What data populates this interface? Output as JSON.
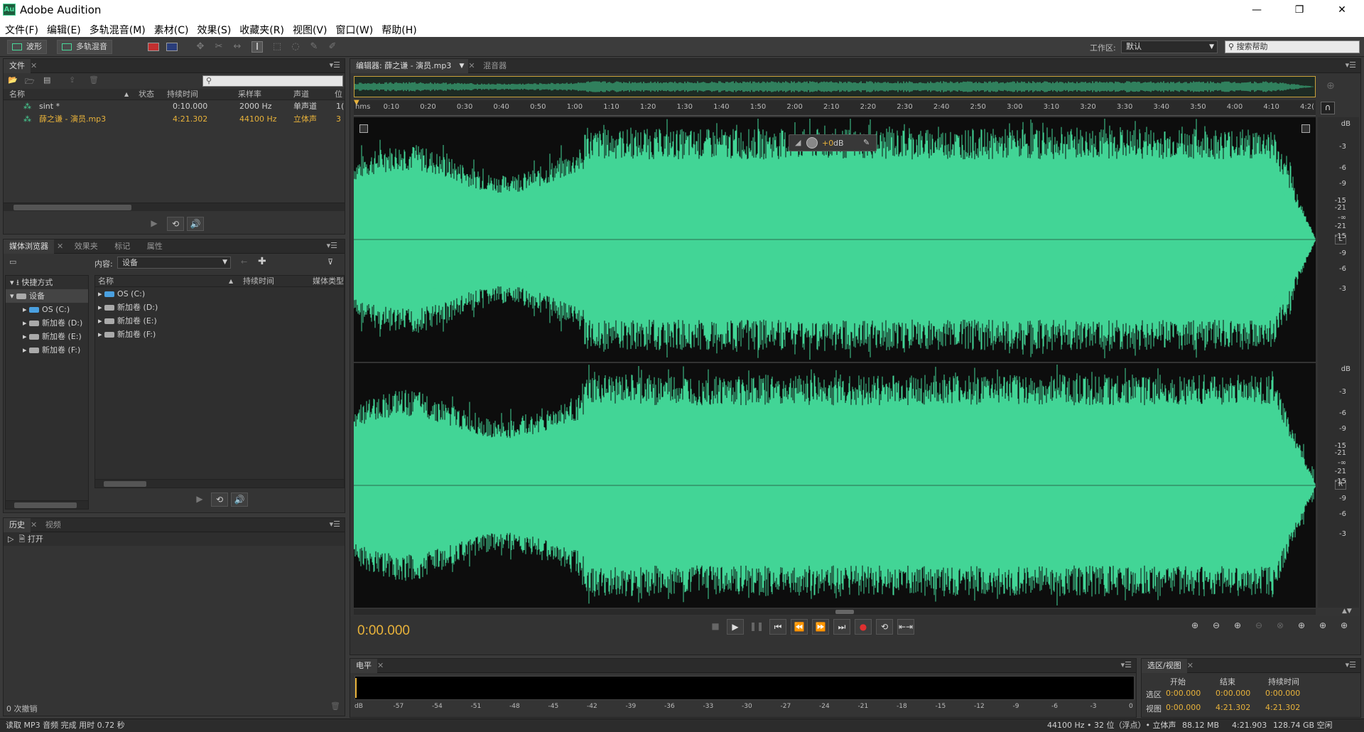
{
  "window": {
    "app_logo": "Au",
    "title": "Adobe Audition",
    "minimize": "—",
    "restore": "❐",
    "close": "✕"
  },
  "menu": [
    "文件(F)",
    "编辑(E)",
    "多轨混音(M)",
    "素材(C)",
    "效果(S)",
    "收藏夹(R)",
    "视图(V)",
    "窗口(W)",
    "帮助(H)"
  ],
  "toolbar": {
    "waveform_label": "波形",
    "multitrack_label": "多轨混音",
    "workspace_label": "工作区:",
    "workspace_value": "默认",
    "search_placeholder": "搜索帮助"
  },
  "files_panel": {
    "tab": "文件",
    "columns": [
      "名称",
      "状态",
      "持续时间",
      "采样率",
      "声道",
      "位"
    ],
    "rows": [
      {
        "name": "sint *",
        "status": "",
        "duration": "0:10.000",
        "rate": "2000 Hz",
        "channels": "单声道",
        "bits": "1("
      },
      {
        "name": "薛之谦 - 演员.mp3",
        "status": "",
        "duration": "4:21.302",
        "rate": "44100 Hz",
        "channels": "立体声",
        "bits": "3"
      }
    ]
  },
  "media_panel": {
    "tabs": [
      "媒体浏览器",
      "效果夹",
      "标记",
      "属性"
    ],
    "content_label": "内容:",
    "content_value": "设备",
    "tree": [
      {
        "label": "快捷方式",
        "level": 0
      },
      {
        "label": "设备",
        "level": 0
      },
      {
        "label": "OS (C:)",
        "level": 1
      },
      {
        "label": "新加卷 (D:)",
        "level": 1
      },
      {
        "label": "新加卷 (E:)",
        "level": 1
      },
      {
        "label": "新加卷 (F:)",
        "level": 1
      }
    ],
    "columns": [
      "名称",
      "持续时间",
      "媒体类型"
    ],
    "rows": [
      "OS (C:)",
      "新加卷 (D:)",
      "新加卷 (E:)",
      "新加卷 (F:)"
    ]
  },
  "history_panel": {
    "tabs": [
      "历史",
      "视频"
    ],
    "items": [
      "打开"
    ],
    "undo_count": "0 次撤销"
  },
  "editor": {
    "tab": "编辑器: 薛之谦 - 演员.mp3",
    "mixer_tab": "混音器",
    "hud_gain": "+0",
    "hud_unit": "dB",
    "ruler": [
      "hms",
      "0:10",
      "0:20",
      "0:30",
      "0:40",
      "0:50",
      "1:00",
      "1:10",
      "1:20",
      "1:30",
      "1:40",
      "1:50",
      "2:00",
      "2:10",
      "2:20",
      "2:30",
      "2:40",
      "2:50",
      "3:00",
      "3:10",
      "3:20",
      "3:30",
      "3:40",
      "3:50",
      "4:00",
      "4:10",
      "4:2("
    ],
    "db_scale": [
      "dB",
      "-3",
      "-6",
      "-9",
      "-15",
      "-21",
      "-∞",
      "-21",
      "-15",
      "-9",
      "-6",
      "-3"
    ],
    "channel_l": "L",
    "channel_r": "R",
    "wave_color": "#42d596",
    "current_time": "0:00.000"
  },
  "levels_panel": {
    "tab": "电平",
    "scale": [
      "dB",
      "-57",
      "-54",
      "-51",
      "-48",
      "-45",
      "-42",
      "-39",
      "-36",
      "-33",
      "-30",
      "-27",
      "-24",
      "-21",
      "-18",
      "-15",
      "-12",
      "-9",
      "-6",
      "-3",
      "0"
    ]
  },
  "selection_panel": {
    "tab": "选区/视图",
    "headers": [
      "开始",
      "结束",
      "持续时间"
    ],
    "selection": {
      "label": "选区",
      "start": "0:00.000",
      "end": "0:00.000",
      "duration": "0:00.000"
    },
    "view": {
      "label": "视图",
      "start": "0:00.000",
      "end": "4:21.302",
      "duration": "4:21.302"
    }
  },
  "status": {
    "message": "读取 MP3 音频 完成 用时 0.72 秒",
    "format": "44100 Hz • 32 位（浮点）• 立体声",
    "size": "88.12 MB",
    "duration": "4:21.903",
    "free": "128.74 GB 空闲"
  }
}
